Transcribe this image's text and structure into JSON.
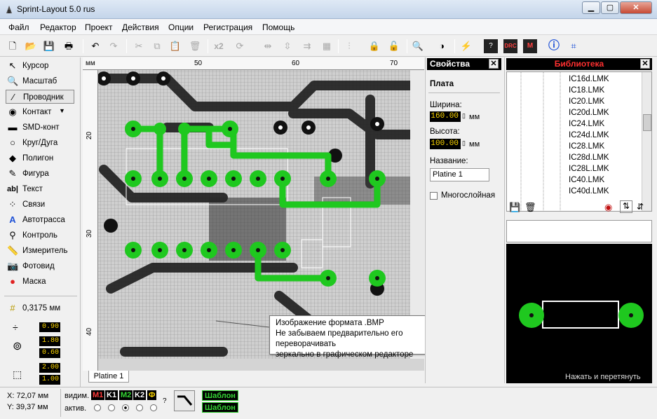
{
  "window": {
    "title": "Sprint-Layout 5.0 rus",
    "minimize": "▁",
    "maximize": "▢",
    "close": "✕"
  },
  "menu": [
    "Файл",
    "Редактор",
    "Проект",
    "Действия",
    "Опции",
    "Регистрация",
    "Помощь"
  ],
  "toolbar": {
    "copies": "x2"
  },
  "tools": [
    {
      "label": "Курсор",
      "icon": "cursor-icon"
    },
    {
      "label": "Масштаб",
      "icon": "zoom-icon"
    },
    {
      "label": "Проводник",
      "icon": "track-icon"
    },
    {
      "label": "Контакт",
      "icon": "pad-icon"
    },
    {
      "label": "SMD-конт",
      "icon": "smd-icon"
    },
    {
      "label": "Круг/Дуга",
      "icon": "circle-icon"
    },
    {
      "label": "Полигон",
      "icon": "polygon-icon"
    },
    {
      "label": "Фигура",
      "icon": "shape-icon"
    },
    {
      "label": "Текст",
      "icon": "text-icon"
    },
    {
      "label": "Связи",
      "icon": "connections-icon"
    },
    {
      "label": "Автотрасса",
      "icon": "autoroute-icon"
    },
    {
      "label": "Контроль",
      "icon": "test-icon"
    },
    {
      "label": "Измеритель",
      "icon": "measure-icon"
    },
    {
      "label": "Фотовид",
      "icon": "photoview-icon"
    },
    {
      "label": "Маска",
      "icon": "mask-icon"
    }
  ],
  "grid": {
    "value": "0,3175 мм"
  },
  "track_values": {
    "width": "0.90",
    "pad_outer": "1.80",
    "pad_inner": "0.60",
    "smd_w": "2.00",
    "smd_h": "1.00"
  },
  "ruler": {
    "unit": "мм",
    "top": [
      "50",
      "60",
      "70"
    ],
    "left": [
      "20",
      "30",
      "40"
    ]
  },
  "tab": "Platine 1",
  "properties": {
    "title": "Свойства",
    "section": "Плата",
    "width_label": "Ширина:",
    "width_value": "160.00",
    "height_label": "Высота:",
    "height_value": "100.00",
    "unit": "мм",
    "name_label": "Название:",
    "name_value": "Platine 1",
    "multilayer_label": "Многослойная"
  },
  "library": {
    "title": "Библиотека",
    "items": [
      "IC16d.LMK",
      "IC18.LMK",
      "IC20.LMK",
      "IC20d.LMK",
      "IC24.LMK",
      "IC24d.LMK",
      "IC28.LMK",
      "IC28d.LMK",
      "IC28L.LMK",
      "IC40.LMK",
      "IC40d.LMK"
    ],
    "hint": "Нажать и перетянуть"
  },
  "tooltip": {
    "line1": "Изображение формата .BMP",
    "line2": "Не забываем предварительно его переворачивать",
    "line3": "зеркально в графическом редакторе"
  },
  "status": {
    "x": "X:  72,07 мм",
    "y": "Y:  39,37 мм",
    "visible_label": "видим.",
    "active_label": "актив.",
    "layers": [
      {
        "label": "M1",
        "color": "#ff3b3b"
      },
      {
        "label": "K1",
        "color": "#ffffff"
      },
      {
        "label": "M2",
        "color": "#35d635"
      },
      {
        "label": "K2",
        "color": "#ffffff"
      },
      {
        "label": "Ф",
        "color": "#ffd800"
      }
    ],
    "question": "?",
    "template1": "Шаблон",
    "template2": "Шаблон"
  },
  "colors": {
    "copper": "#1fc81f",
    "board_bg": "#d4d4d4",
    "display_yellow": "#ffd800"
  }
}
